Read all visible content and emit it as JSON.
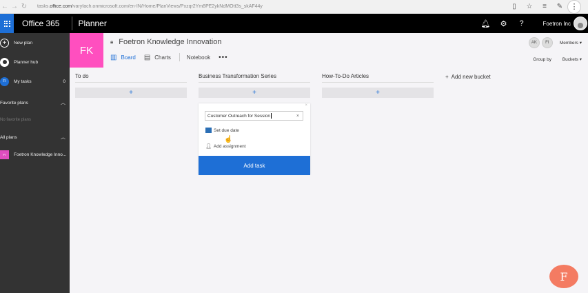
{
  "browser": {
    "url_prefix": "tasks.",
    "url_domain": "office.com",
    "url_rest": "/varyfach.onmicrosoft.com/en-IN/Home/PlanViews/Pxzqr2Ym8PE2ykNdMOtt3s_skAF44y"
  },
  "suite": {
    "brand": "Office 365",
    "app": "Planner",
    "tenant": "Foetron Inc"
  },
  "sidebar": {
    "new_plan": "New plan",
    "planner_hub": "Planner hub",
    "my_tasks": "My tasks",
    "my_tasks_badge": "FI",
    "my_tasks_count": "0",
    "favorite_header": "Favorite plans",
    "favorite_empty": "No favorite plans",
    "all_header": "All plans",
    "plan_badge": "FI",
    "plan_name": "Foetron Knowledge Inno..."
  },
  "header": {
    "badge": "FK",
    "title": "Foetron Knowledge Innovation",
    "tabs": [
      "Board",
      "Charts",
      "Notebook"
    ],
    "members": [
      "AK",
      "FI"
    ],
    "members_label": "Members",
    "groupby_label": "Group by",
    "groupby_value": "Buckets"
  },
  "board": {
    "buckets": [
      {
        "name": "To do",
        "add": "+"
      },
      {
        "name": "Business Transformation Series",
        "add": "+"
      },
      {
        "name": "How-To-Do Articles",
        "add": "+"
      }
    ],
    "add_bucket": "Add new bucket",
    "new_task": {
      "value": "Customer Outreach for Session",
      "due_date": "Set due date",
      "assignment": "Add assignment",
      "add_button": "Add task"
    }
  },
  "logo": "F",
  "colors": {
    "accent": "#1e6fd6",
    "plan_tile": "#ff4fbf",
    "sidebar": "#333333",
    "suite_bar": "#000000"
  }
}
